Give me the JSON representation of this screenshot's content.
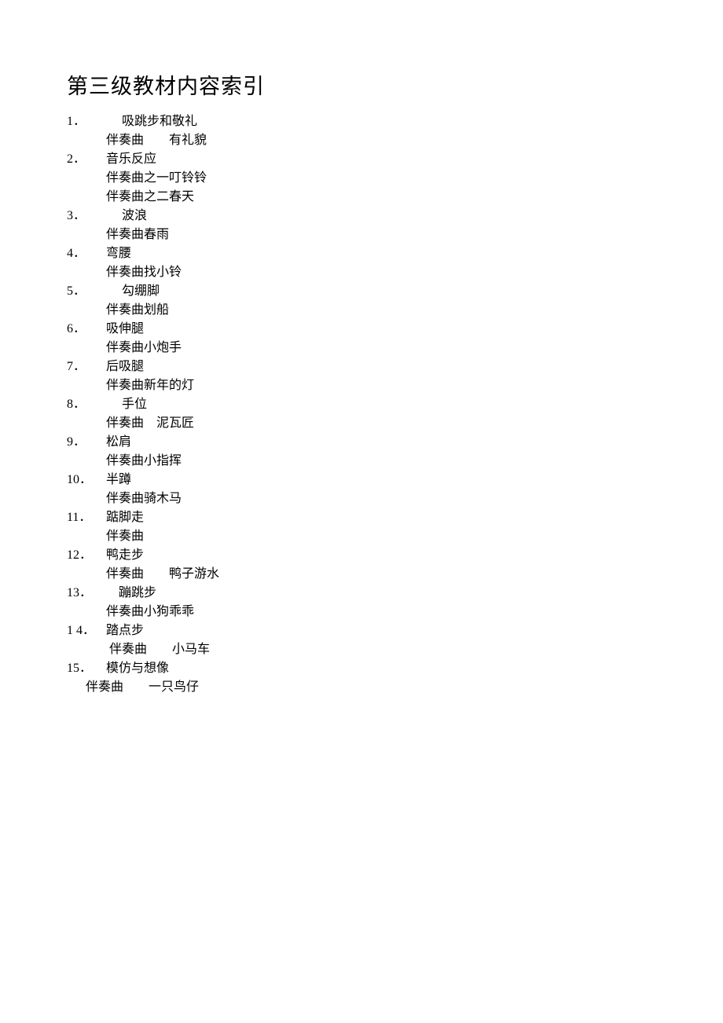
{
  "title": "第三级教材内容索引",
  "items": [
    {
      "num": "1．",
      "title_indent": "     ",
      "title": "吸跳步和敬礼",
      "subs": [
        {
          "text": "伴奏曲　　有礼貌",
          "indent": "normal"
        }
      ]
    },
    {
      "num": "2．",
      "title_indent": "",
      "title": "音乐反应",
      "subs": [
        {
          "text": "伴奏曲之一叮铃铃",
          "indent": "normal"
        },
        {
          "text": "伴奏曲之二春天",
          "indent": "normal"
        }
      ]
    },
    {
      "num": "3．",
      "title_indent": "     ",
      "title": "波浪",
      "subs": [
        {
          "text": "伴奏曲春雨",
          "indent": "normal"
        }
      ]
    },
    {
      "num": "4．",
      "title_indent": "",
      "title": "弯腰",
      "subs": [
        {
          "text": "伴奏曲找小铃",
          "indent": "normal"
        }
      ]
    },
    {
      "num": "5．",
      "title_indent": "     ",
      "title": "勾绷脚",
      "subs": [
        {
          "text": "伴奏曲划船",
          "indent": "normal"
        }
      ]
    },
    {
      "num": "6．",
      "title_indent": "",
      "title": "吸伸腿",
      "subs": [
        {
          "text": "伴奏曲小炮手",
          "indent": "normal"
        }
      ]
    },
    {
      "num": "7．",
      "title_indent": "",
      "title": "后吸腿",
      "subs": [
        {
          "text": "伴奏曲新年的灯",
          "indent": "normal"
        }
      ]
    },
    {
      "num": "8．",
      "title_indent": "     ",
      "title": "手位",
      "subs": [
        {
          "text": "伴奏曲　泥瓦匠",
          "indent": "normal"
        }
      ]
    },
    {
      "num": "9．",
      "title_indent": "",
      "title": "松肩",
      "subs": [
        {
          "text": "伴奏曲小指挥",
          "indent": "normal"
        }
      ]
    },
    {
      "num": "10．",
      "title_indent": "",
      "title": "半蹲",
      "subs": [
        {
          "text": "伴奏曲骑木马",
          "indent": "normal"
        }
      ]
    },
    {
      "num": "11．",
      "title_indent": "",
      "title": "踮脚走",
      "subs": [
        {
          "text": "伴奏曲",
          "indent": "normal"
        }
      ]
    },
    {
      "num": "12．",
      "title_indent": "",
      "title": "鸭走步",
      "subs": [
        {
          "text": "伴奏曲　　鸭子游水",
          "indent": "normal"
        }
      ]
    },
    {
      "num": "13．",
      "title_indent": "    ",
      "title": "蹦跳步",
      "subs": [
        {
          "text": "伴奏曲小狗乖乖",
          "indent": "normal"
        }
      ]
    },
    {
      "num": "1 4．",
      "title_indent": "",
      "title": "踏点步",
      "subs": [
        {
          "text": " 伴奏曲　　小马车",
          "indent": "normal"
        }
      ]
    },
    {
      "num": "15．",
      "title_indent": "",
      "title": "模仿与想像",
      "subs": [
        {
          "text": "伴奏曲　　一只鸟仔",
          "indent": "alt"
        }
      ]
    }
  ]
}
